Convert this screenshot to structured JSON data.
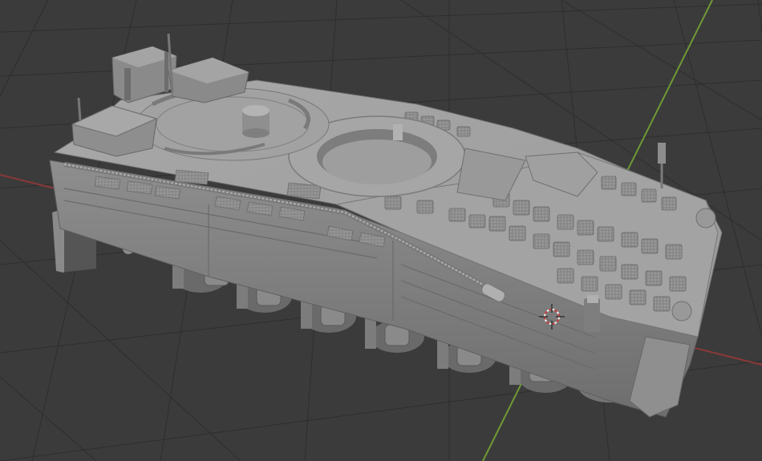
{
  "app": "3d-modeling-viewport",
  "viewport": {
    "background_color": "#3b3b3b",
    "grid_line_color": "#2e2e2e",
    "x_axis_color": "#8b3838",
    "y_axis_color": "#6e9a35",
    "model_base_color": "#9a9a9a",
    "model_highlight_color": "#b8b8b8",
    "model_shadow_color": "#6a6a6a",
    "cursor_colors": [
      "#c43a3a",
      "#f0f0f0"
    ]
  },
  "scene": {
    "object": "armored-vehicle-hull-model",
    "icons": [
      "3d-cursor-icon"
    ]
  }
}
